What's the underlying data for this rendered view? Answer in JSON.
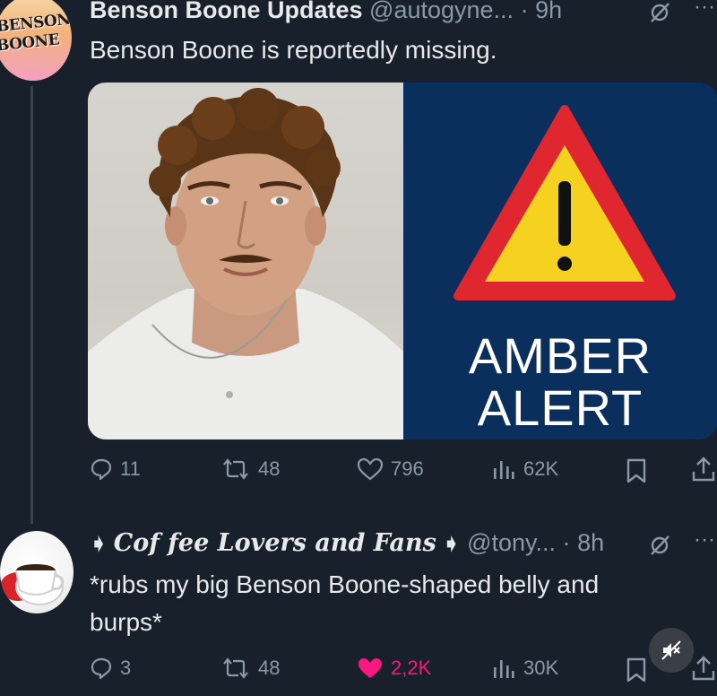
{
  "tweet1": {
    "avatar_text_line1": "BENSON",
    "avatar_text_line2": "BOONE",
    "display_name": "Benson Boone Updates",
    "handle": "@autogyne...",
    "separator": "·",
    "time": "9h",
    "more": "···",
    "text": "Benson Boone is reportedly missing.",
    "media": {
      "alert_line1": "AMBER",
      "alert_line2": "ALERT"
    },
    "actions": {
      "replies": "11",
      "reposts": "48",
      "likes": "796",
      "views": "62K"
    }
  },
  "tweet2": {
    "display_name": "Cof fee Lovers and Fans",
    "handle": "@tony...",
    "separator": "·",
    "time": "8h",
    "more": "···",
    "text_line1": "*rubs my big Benson Boone-shaped belly and",
    "text_line2": "burps*",
    "actions": {
      "replies": "3",
      "reposts": "48",
      "likes": "2,2K",
      "views": "30K"
    }
  },
  "colors": {
    "background": "#17202b",
    "muted": "#8b98a5",
    "like_active": "#f91880",
    "alert_red": "#e0262f",
    "alert_yellow": "#f4d21f",
    "alert_bg": "#0b2f5c"
  }
}
